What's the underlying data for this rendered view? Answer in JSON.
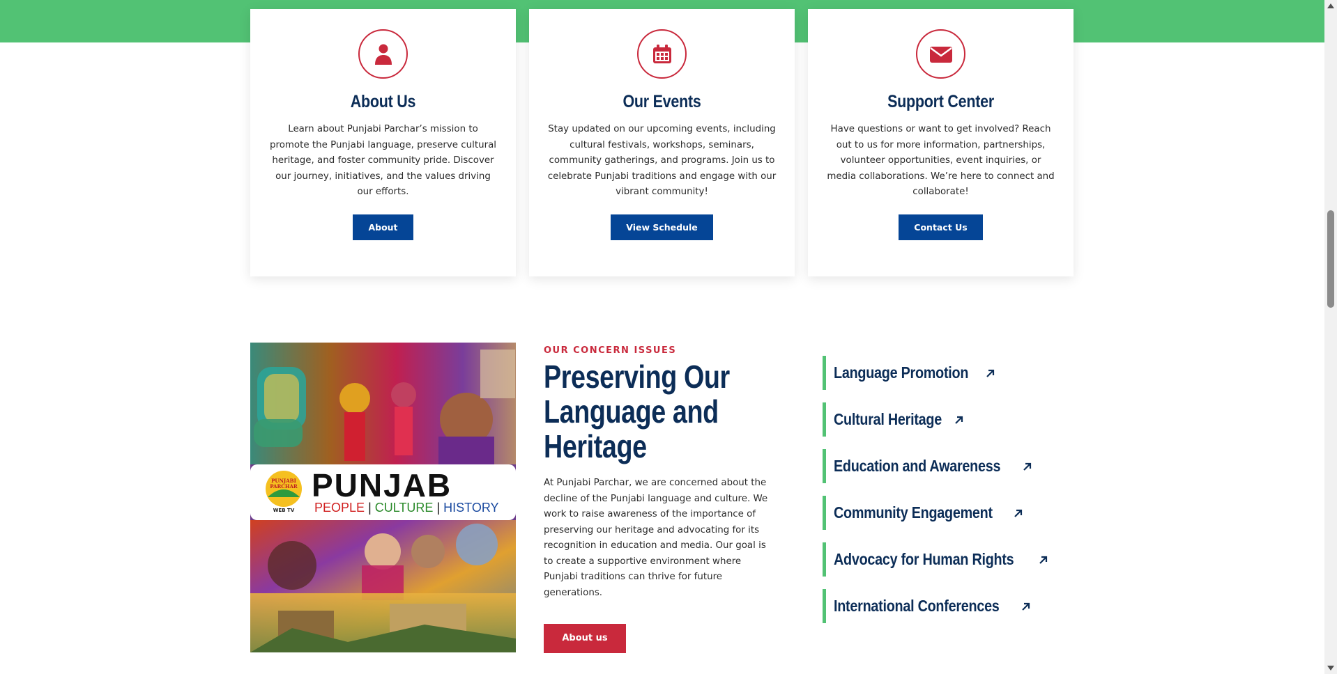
{
  "cards": [
    {
      "icon": "user-icon",
      "title": "About Us",
      "text": "Learn about Punjabi Parchar’s mission to promote the Punjabi language, preserve cultural heritage, and foster community pride. Discover our journey, initiatives, and the values driving our efforts.",
      "button": "About"
    },
    {
      "icon": "calendar-icon",
      "title": "Our Events",
      "text": "Stay updated on our upcoming events, including cultural festivals, workshops, seminars, community gatherings, and programs. Join us to celebrate Punjabi traditions and engage with our vibrant community!",
      "button": "View Schedule"
    },
    {
      "icon": "envelope-icon",
      "title": "Support Center",
      "text": "Have questions or want to get involved? Reach out to us for more information, partnerships, volunteer opportunities, event inquiries, or media collaborations. We’re here to connect and collaborate!",
      "button": "Contact Us"
    }
  ],
  "concern": {
    "eyebrow": "OUR CONCERN ISSUES",
    "heading": "Preserving Our Language and Heritage",
    "body": "At Punjabi Parchar, we are concerned about the decline of the Punjabi language and culture. We work to raise awareness of the importance of preserving our heritage and advocating for its recognition in education and media. Our goal is to create a supportive environment where Punjabi traditions can thrive for future generations.",
    "button": "About us",
    "image": {
      "logo_top": "PUNJABI",
      "logo_mid": "PARCHAR",
      "logo_bottom": "WEB TV",
      "title": "PUNJAB",
      "word1": "PEOPLE",
      "sep": "|",
      "word2": "CULTURE",
      "word3": "HISTORY"
    }
  },
  "issues": [
    "Language Promotion",
    "Cultural Heritage",
    "Education and Awareness",
    "Community Engagement",
    "Advocacy for Human Rights",
    "International Conferences"
  ],
  "colors": {
    "green": "#52c274",
    "red": "#c9293c",
    "navy": "#0c2d57",
    "blue_button": "#054596"
  }
}
